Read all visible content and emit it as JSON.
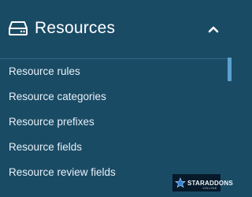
{
  "section": {
    "title": "Resources",
    "icon": "hard-drive-icon",
    "toggle_icon": "chevron-up-icon",
    "expanded": true
  },
  "menu": {
    "items": [
      {
        "label": "Resource rules"
      },
      {
        "label": "Resource categories"
      },
      {
        "label": "Resource prefixes"
      },
      {
        "label": "Resource fields"
      },
      {
        "label": "Resource review fields"
      }
    ]
  },
  "watermark": {
    "brand": "STARADDONS",
    "sub": "ONLINE"
  },
  "colors": {
    "background": "#1a4b65",
    "text": "#e7f0f6",
    "accent": "#5aa2cf",
    "watermark_bg": "#061a2a"
  }
}
